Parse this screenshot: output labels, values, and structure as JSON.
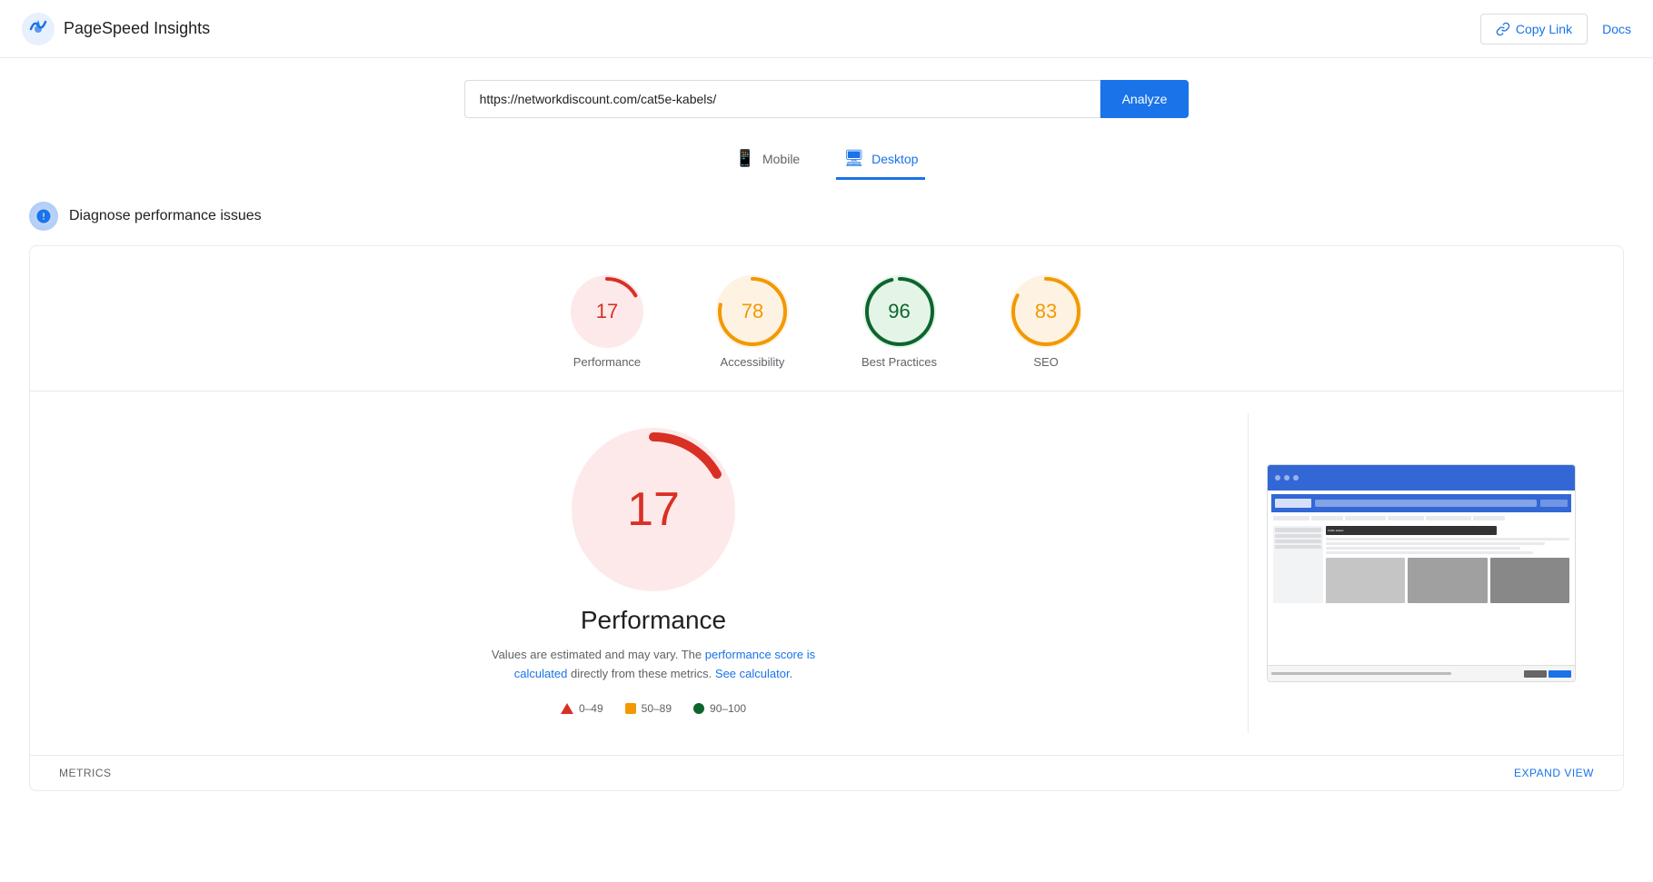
{
  "app": {
    "title": "PageSpeed Insights",
    "logo_alt": "PageSpeed Insights Logo"
  },
  "header": {
    "copy_link_label": "Copy Link",
    "docs_label": "Docs"
  },
  "search": {
    "url_value": "https://networkdiscount.com/cat5e-kabels/",
    "url_placeholder": "Enter a web page URL",
    "analyze_label": "Analyze"
  },
  "tabs": [
    {
      "id": "mobile",
      "label": "Mobile",
      "icon": "📱",
      "active": false
    },
    {
      "id": "desktop",
      "label": "Desktop",
      "icon": "🖥",
      "active": true
    }
  ],
  "diagnose": {
    "title": "Diagnose performance issues"
  },
  "scores": [
    {
      "id": "performance",
      "value": 17,
      "label": "Performance",
      "color_class": "red"
    },
    {
      "id": "accessibility",
      "value": 78,
      "label": "Accessibility",
      "color_class": "orange"
    },
    {
      "id": "best-practices",
      "value": 96,
      "label": "Best Practices",
      "color_class": "green"
    },
    {
      "id": "seo",
      "value": 83,
      "label": "SEO",
      "color_class": "orange"
    }
  ],
  "performance_detail": {
    "score": 17,
    "title": "Performance",
    "description_before": "Values are estimated and may vary. The",
    "link1_text": "performance score is calculated",
    "description_middle": "directly from these metrics.",
    "link2_text": "See calculator.",
    "description_end": ""
  },
  "legend": [
    {
      "id": "low",
      "range": "0–49",
      "type": "triangle",
      "color": "#d93025"
    },
    {
      "id": "medium",
      "range": "50–89",
      "type": "square",
      "color": "#f29900"
    },
    {
      "id": "high",
      "range": "90–100",
      "type": "circle",
      "color": "#0d652d"
    }
  ],
  "footer": {
    "metrics_label": "METRICS",
    "expand_label": "Expand view"
  },
  "colors": {
    "red": "#d93025",
    "orange": "#f29900",
    "green": "#0d652d",
    "red_bg": "#fde9e9",
    "orange_bg": "#fef3e2",
    "green_bg": "#e4f5e8",
    "blue": "#1a73e8"
  }
}
